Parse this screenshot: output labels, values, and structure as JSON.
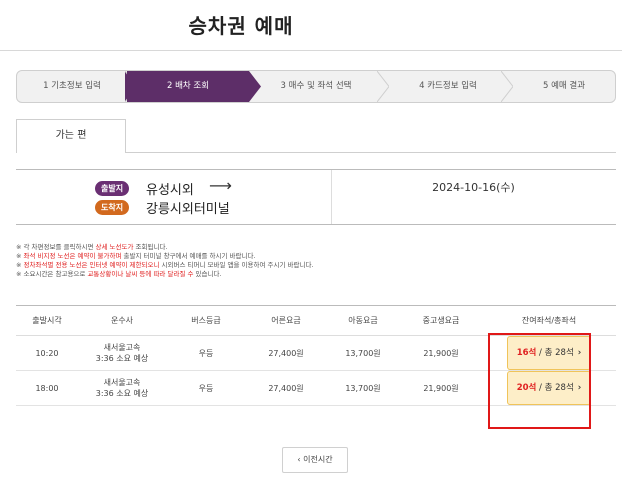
{
  "page": {
    "title": "승차권 예매"
  },
  "stepper": {
    "steps": [
      {
        "label": "1 기초정보 입력",
        "active": false
      },
      {
        "label": "2 배차 조회",
        "active": true
      },
      {
        "label": "3 매수 및 좌석 선택",
        "active": false
      },
      {
        "label": "4 카드정보 입력",
        "active": false
      },
      {
        "label": "5 예매 결과",
        "active": false
      }
    ],
    "active_color": "#5d2e68"
  },
  "tabs": {
    "outbound_label": "가는 편"
  },
  "route": {
    "departure_badge": "출발지",
    "departure_name": "유성시외",
    "arrival_badge": "도착지",
    "arrival_name": "강릉시외터미널",
    "arrow": "⟶",
    "date": "2024-10-16(수)",
    "departure_badge_color": "#6a2f73",
    "arrival_badge_color": "#d2691e"
  },
  "notices": [
    {
      "prefix": "※ 각 차편정보를 클릭하시면 ",
      "red": "상세 노선도가",
      "suffix": " 조회됩니다."
    },
    {
      "prefix": "※ ",
      "red": "좌석 비지정 노선은 예약이 불가하며",
      "suffix": " 출발지 터미널 창구에서 예매를 하시기 바랍니다."
    },
    {
      "prefix": "※ ",
      "red": "정차좌석별 전용 노선은 인터넷 예약이 제한되오니",
      "suffix": " 시외버스 티머니 모바일 앱을 이용하여 주시기 바랍니다."
    },
    {
      "prefix": "※ 소요시간은 참고용으로 ",
      "red": "교통상황이나 날씨 등에 따라 달라질 수",
      "suffix": " 있습니다."
    }
  ],
  "table": {
    "headers": [
      "출발시각",
      "운수사",
      "버스등급",
      "어른요금",
      "아동요금",
      "중고생요금",
      "잔여좌석/총좌석"
    ],
    "rows": [
      {
        "time": "10:20",
        "carrier": "새서울고속",
        "duration": "3:36 소요 예상",
        "grade": "우등",
        "adult": "27,400원",
        "child": "13,700원",
        "youth": "21,900원",
        "seats_available": "16석",
        "seats_total": " / 총 28석",
        "chevron": "›"
      },
      {
        "time": "18:00",
        "carrier": "새서울고속",
        "duration": "3:36 소요 예상",
        "grade": "우등",
        "adult": "27,400원",
        "child": "13,700원",
        "youth": "21,900원",
        "seats_available": "20석",
        "seats_total": " / 총 28석",
        "chevron": "›"
      }
    ]
  },
  "pagination": {
    "prev_label": "‹ 이전시간"
  },
  "colors": {
    "seat_button_bg": "#fdeec8",
    "seat_available": "#e02020",
    "highlight": "#e01818"
  }
}
